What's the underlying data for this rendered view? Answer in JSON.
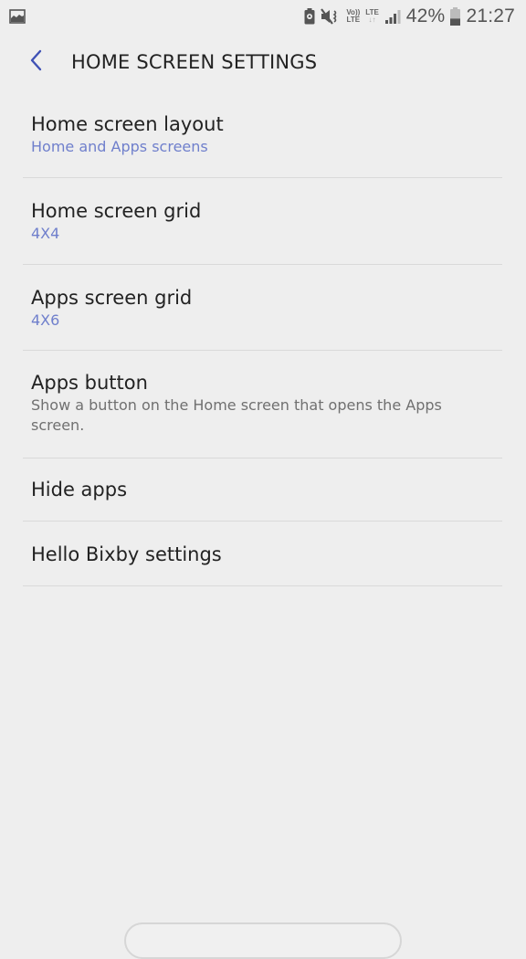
{
  "status_bar": {
    "left_icons": [
      "gallery-notification-icon"
    ],
    "right_icons": [
      "battery-saver-icon",
      "mute-icon",
      "volte-icon",
      "lte-data-icon",
      "signal-icon"
    ],
    "volte_label_top": "Vo))",
    "volte_label_bottom": "LTE",
    "lte_label": "LTE",
    "battery_percent": "42%",
    "battery_level": 0.42,
    "time": "21:27"
  },
  "header": {
    "back_icon": "chevron-left-icon",
    "title": "HOME SCREEN SETTINGS",
    "accent_color": "#3f51b5"
  },
  "settings": {
    "items": [
      {
        "title": "Home screen layout",
        "subtitle": "Home and Apps screens",
        "subtitle_style": "accent"
      },
      {
        "title": "Home screen grid",
        "subtitle": "4X4",
        "subtitle_style": "accent"
      },
      {
        "title": "Apps screen grid",
        "subtitle": "4X6",
        "subtitle_style": "accent"
      },
      {
        "title": "Apps button",
        "subtitle": "Show a button on the Home screen that opens the Apps screen.",
        "subtitle_style": "muted"
      },
      {
        "title": "Hide apps"
      },
      {
        "title": "Hello Bixby settings"
      }
    ],
    "accent_subtitle_color": "#6f7fcc"
  }
}
